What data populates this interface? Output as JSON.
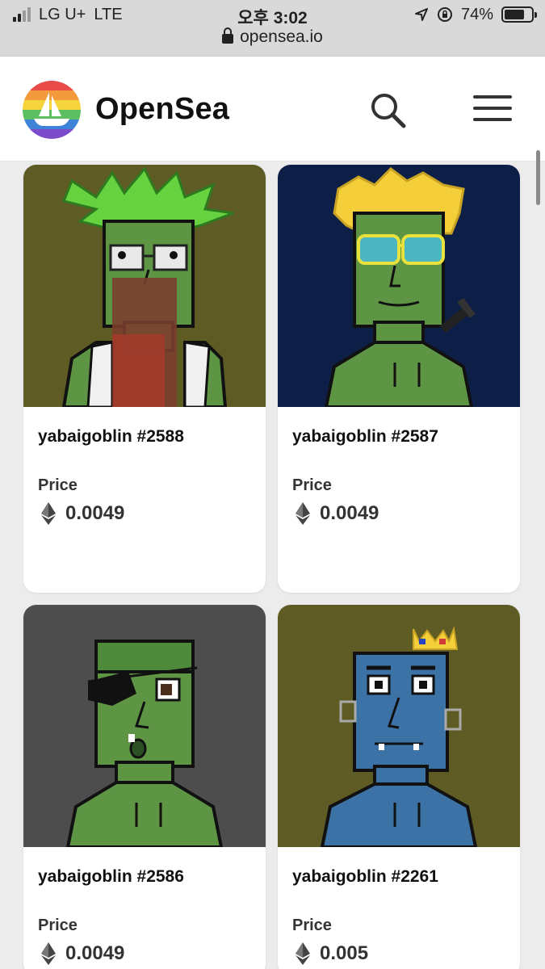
{
  "status_bar": {
    "carrier": "LG U+",
    "network": "LTE",
    "time": "오후 3:02",
    "battery": "74%",
    "battery_level": 0.74,
    "url": "opensea.io"
  },
  "header": {
    "brand": "OpenSea"
  },
  "icons": {
    "logo": "opensea-logo",
    "search": "search-icon",
    "menu": "hamburger-menu-icon",
    "currency": "ethereum-icon"
  },
  "colors": {
    "brand_text": "#111111",
    "card_bg": "#ffffff",
    "page_bg": "#ececec",
    "bg_olive": "#5e5b25",
    "bg_navy": "#0d1f46",
    "bg_gray": "#4d4d4d",
    "goblin_green": "#5e9545",
    "goblin_blue": "#3c72a6"
  },
  "items": [
    {
      "name": "yabaigoblin #2588",
      "price_label": "Price",
      "price": "0.0049"
    },
    {
      "name": "yabaigoblin #2587",
      "price_label": "Price",
      "price": "0.0049"
    },
    {
      "name": "yabaigoblin #2586",
      "price_label": "Price",
      "price": "0.0049"
    },
    {
      "name": "yabaigoblin #2261",
      "price_label": "Price",
      "price": "0.005"
    }
  ]
}
